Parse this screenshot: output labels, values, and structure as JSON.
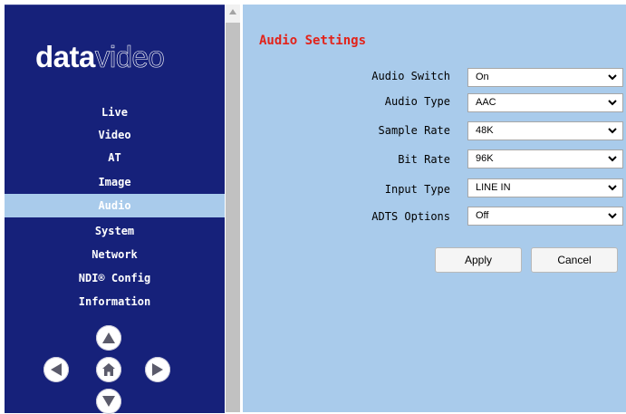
{
  "brand": {
    "logo_bold": "data",
    "logo_outline": "video"
  },
  "nav": {
    "items": [
      {
        "label": "Live"
      },
      {
        "label": "Video"
      },
      {
        "label": "AT"
      },
      {
        "label": "Image"
      },
      {
        "label": "Audio",
        "active": true
      },
      {
        "label": "System"
      },
      {
        "label": "Network"
      },
      {
        "label": "NDI® Config"
      },
      {
        "label": "Information"
      }
    ]
  },
  "ptz": {
    "up": "arrow-up-icon",
    "left": "arrow-left-icon",
    "home": "home-icon",
    "right": "arrow-right-icon",
    "down": "arrow-down-icon"
  },
  "page": {
    "title": "Audio Settings"
  },
  "settings": [
    {
      "label": "Audio Switch",
      "value": "On"
    },
    {
      "label": "Audio Type",
      "value": "AAC"
    },
    {
      "label": "Sample Rate",
      "value": "48K"
    },
    {
      "label": "Bit Rate",
      "value": "96K"
    },
    {
      "label": "Input Type",
      "value": "LINE IN"
    },
    {
      "label": "ADTS Options",
      "value": "Off"
    }
  ],
  "actions": {
    "apply": "Apply",
    "cancel": "Cancel"
  },
  "colors": {
    "sidebar_bg": "#16217a",
    "active_item_bg": "#a9cbeb",
    "main_bg": "#a9cbeb",
    "title_red": "#e2231a"
  }
}
